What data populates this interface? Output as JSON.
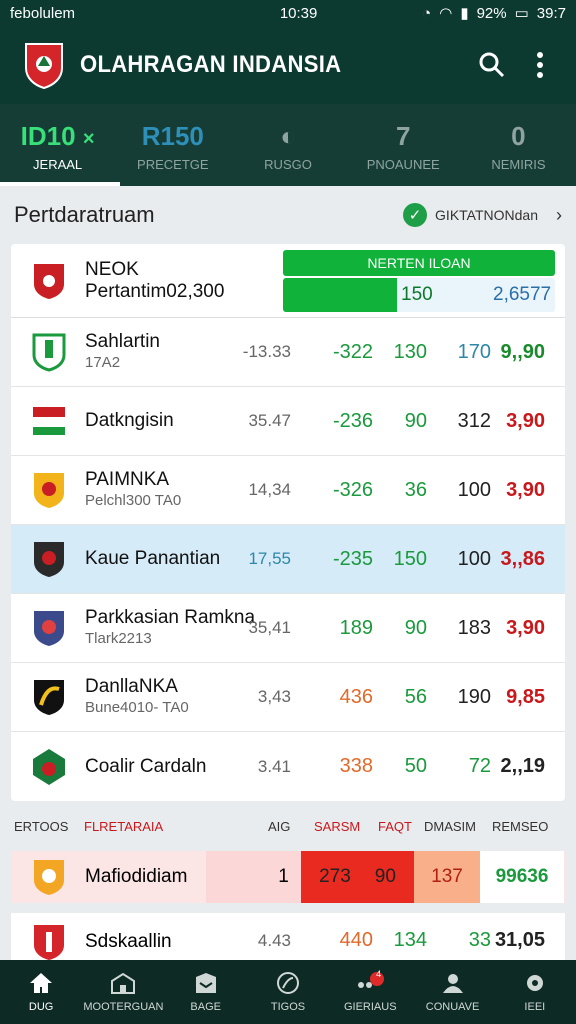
{
  "status_bar": {
    "carrier": "febolulem",
    "time": "10:39",
    "battery_percent": "92%",
    "right_text": "39:7"
  },
  "app": {
    "title": "OLAHRAGAN INDANSIA"
  },
  "tabs": [
    {
      "value": "ID10",
      "label": "JERAAL",
      "active": true
    },
    {
      "value": "R150",
      "label": "PRECETGE"
    },
    {
      "value": "",
      "label": "RUSGO"
    },
    {
      "value": "7",
      "label": "PNOAUNEE"
    },
    {
      "value": "0",
      "label": "NEMIRIS"
    }
  ],
  "section": {
    "title": "Pertdaratruam",
    "filter_label": "GIKTATNONdan"
  },
  "top_card": {
    "name": "NEOK",
    "subname": "Pertantim02,300",
    "bar_label": "NERTEN ILOAN",
    "value1": "150",
    "value2": "2,6577",
    "fill": 0.42
  },
  "rows": [
    {
      "name": "Sahlartin",
      "sub": "17A2",
      "c1": "-13.33",
      "c2": "-322",
      "c3": "130",
      "c4": "170",
      "c5": "9,,90"
    },
    {
      "name": "Datkngisin",
      "sub": "",
      "c1": "35.47",
      "c2": "-236",
      "c3": "90",
      "c4": "312",
      "c5": "3,90"
    },
    {
      "name": "PAIMNKA",
      "sub": "Pelchl300 TA0",
      "c1": "14,34",
      "c2": "-326",
      "c3": "36",
      "c4": "100",
      "c5": "3,90"
    },
    {
      "name": "Kaue Panantian",
      "sub": "",
      "c1": "17,55",
      "c2": "-235",
      "c3": "150",
      "c4": "100",
      "c5": "3,,86"
    },
    {
      "name": "Parkkasian Ramkna",
      "sub": "Tlark2213",
      "c1": "35,41",
      "c2": "189",
      "c3": "90",
      "c4": "183",
      "c5": "3,90"
    },
    {
      "name": "DanllaNKA",
      "sub": "Bune4010- TA0",
      "c1": "3,43",
      "c2": "436",
      "c3": "56",
      "c4": "190",
      "c5": "9,85"
    },
    {
      "name": "Coalir Cardaln",
      "sub": "",
      "c1": "3.41",
      "c2": "338",
      "c3": "50",
      "c4": "72",
      "c5": "2,,19"
    }
  ],
  "header2": {
    "col0": "ERTOOS",
    "col1": "FLRETARAIA",
    "col2": "AIG",
    "col3": "SARSM",
    "col4": "FAQT",
    "col5": "DMASIM",
    "col6": "REMSEO"
  },
  "bottom_rows": [
    {
      "name": "Mafiodidiam",
      "v1": "1",
      "v2": "273",
      "v3": "90",
      "v4": "137",
      "v5": "99636"
    },
    {
      "name": "Sdskaallin",
      "v1": "4.43",
      "v2": "440",
      "v3": "134",
      "v4": "33",
      "v5": "31,05"
    }
  ],
  "bottom_nav": [
    {
      "label": "DUG",
      "icon": "home-icon",
      "active": true
    },
    {
      "label": "MOOTERGUAN",
      "icon": "stadium-icon"
    },
    {
      "label": "BAGE",
      "icon": "news-icon"
    },
    {
      "label": "TIGOS",
      "icon": "ball-icon"
    },
    {
      "label": "GIERIAUS",
      "icon": "chat-icon",
      "badge": "4"
    },
    {
      "label": "CONUAVE",
      "icon": "profile-icon"
    },
    {
      "label": "IEEI",
      "icon": "settings-icon"
    }
  ],
  "colors": {
    "primary": "#0d3a30",
    "accent": "#11b23a",
    "red": "#c8181c",
    "highlight": "#d6ebf8"
  }
}
